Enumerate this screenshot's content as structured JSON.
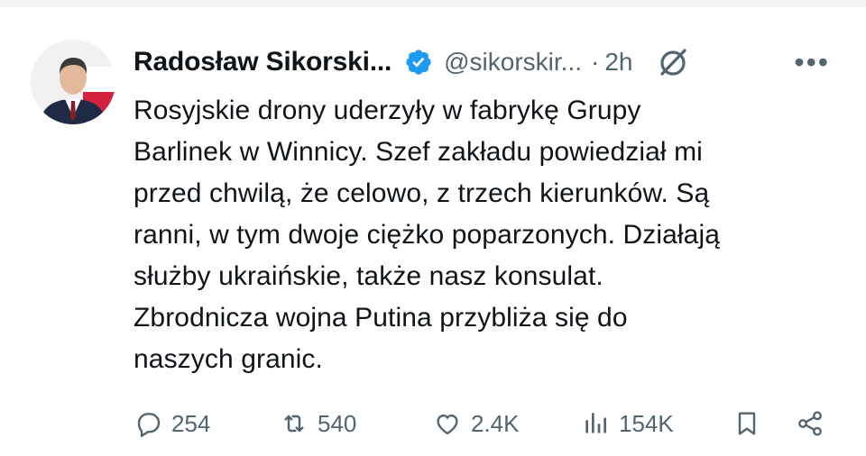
{
  "author": {
    "name": "Radosław Sikorski...",
    "handle": "@sikorskir...",
    "separator": "·",
    "time": "2h",
    "verified": true,
    "accent_color": "#1d9bf0"
  },
  "icons": {
    "verified": "verified-badge-icon",
    "grok": "grok-icon",
    "more": "more-options-icon",
    "reply": "reply-icon",
    "retweet": "retweet-icon",
    "like": "heart-icon",
    "views": "views-chart-icon",
    "bookmark": "bookmark-icon",
    "share": "share-icon"
  },
  "tweet": {
    "lines": [
      "Rosyjskie drony uderzyły w fabrykę Grupy",
      "Barlinek w Winnicy. Szef zakładu powiedział mi",
      "przed chwilą, że celowo, z trzech kierunków. Są",
      "ranni, w tym dwoje ciężko poparzonych. Działają",
      "służby ukraińskie, także nasz konsulat.",
      "Zbrodnicza wojna Putina przybliża się do",
      "naszych granic."
    ]
  },
  "actions": {
    "replies": "254",
    "retweets": "540",
    "likes": "2.4K",
    "views": "154K"
  },
  "more_label": "•••"
}
